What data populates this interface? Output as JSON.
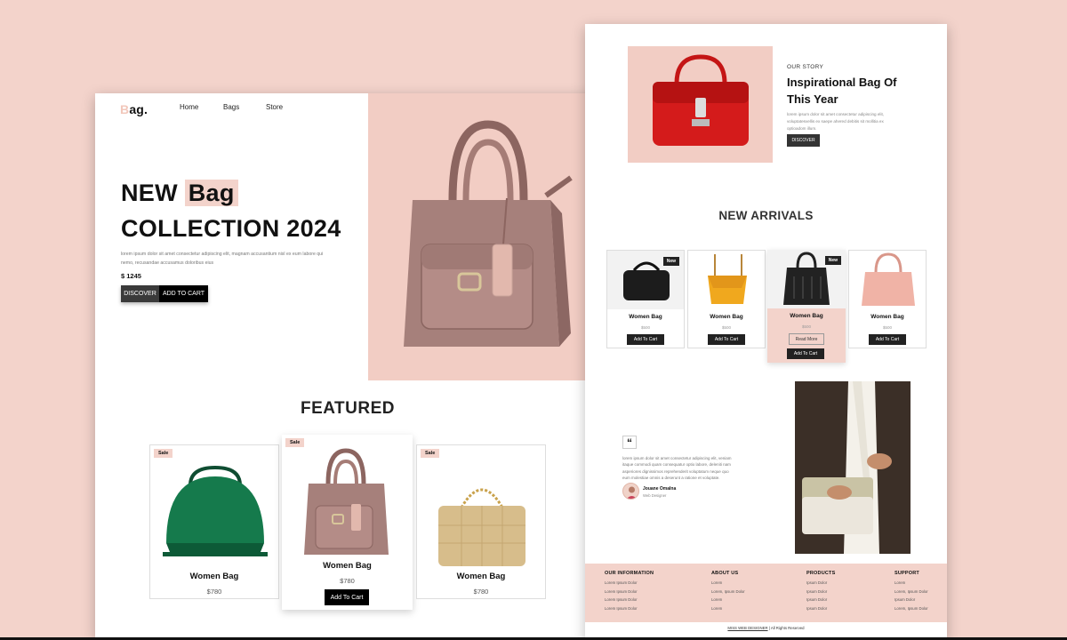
{
  "left": {
    "logo": {
      "first": "B",
      "rest": "ag."
    },
    "nav": [
      "Home",
      "Bags",
      "Store"
    ],
    "hero": {
      "title_word1": "NEW",
      "title_highlight": "Bag",
      "title_line2": "COLLECTION 2024",
      "desc": "lorem ipsum dolor sit amet consectetur adipiscing elit, magnam accusantium nisl ex eum labore qui nemo, recusandae accusamus doloribus eius",
      "price": "$ 1245",
      "discover": "DISCOVER",
      "add_to_cart": "ADD TO CART"
    },
    "featured": {
      "title": "FEATURED",
      "cards": [
        {
          "badge": "Sale",
          "name": "Women Bag",
          "price": "$780"
        },
        {
          "badge": "Sale",
          "name": "Women Bag",
          "price": "$780",
          "button": "Add To Cart"
        },
        {
          "badge": "Sale",
          "name": "Women Bag",
          "price": "$780"
        }
      ]
    }
  },
  "right": {
    "story": {
      "kicker": "OUR STORY",
      "title": "Inspirational Bag Of This Year",
      "desc": "lorem ipsum dolor sit amet consectetur adipiscing elit, voluptatesvellis ex saepe ahered debitis sit mollitia ex optioadom illum.",
      "button": "DISCOVER"
    },
    "arrivals": {
      "title": "NEW ARRIVALS",
      "cards": [
        {
          "badge": "New",
          "name": "Women Bag",
          "price": "$500",
          "button": "Add To Cart"
        },
        {
          "badge": "",
          "name": "Women Bag",
          "price": "$500",
          "button": "Add To Cart"
        },
        {
          "badge": "New",
          "name": "Women Bag",
          "price": "$500",
          "more": "Read More",
          "button": "Add To Cart"
        },
        {
          "badge": "",
          "name": "Women Bag",
          "price": "$500",
          "button": "Add To Cart"
        }
      ]
    },
    "testimonial": {
      "quote_mark": "“",
      "text": "lorem ipsum dolor sit amet consectetur adipiscing elit, veniam itaque commodi quam consequatur optio labore, deleniti nam asperiores dignissimos reprehenderit voluptatum neque quo eum molestiae omnis a deserunt a ratione et voluptate.",
      "name": "Jouane Omalna",
      "role": "Web Designer"
    },
    "footer": {
      "columns": [
        {
          "heading": "OUR INFORMATION",
          "items": [
            "Lorem Ipsum Dolor",
            "Lorem Ipsum Dolor",
            "Lorem Ipsum Dolor",
            "Lorem Ipsum Dolor"
          ]
        },
        {
          "heading": "ABOUT US",
          "items": [
            "Lorem",
            "Lorem, Ipsum Dolor",
            "Lorem",
            "Lorem"
          ]
        },
        {
          "heading": "PRODUCTS",
          "items": [
            "Ipsum Dolor",
            "Ipsum Dolor",
            "Ipsum Dolor",
            "Ipsum Dolor"
          ]
        },
        {
          "heading": "SUPPORT",
          "items": [
            "Lorem",
            "Lorem, Ipsum Dolor",
            "Ipsum Dolor",
            "Lorem, Ipsum Dolor"
          ]
        }
      ],
      "copyright_link": "MISS WEB DESIGNER",
      "copyright_rest": "| All Rights Reserved"
    }
  },
  "colors": {
    "background": "#f3d3cb",
    "accent": "#f2cdc4",
    "dark": "#222222"
  }
}
